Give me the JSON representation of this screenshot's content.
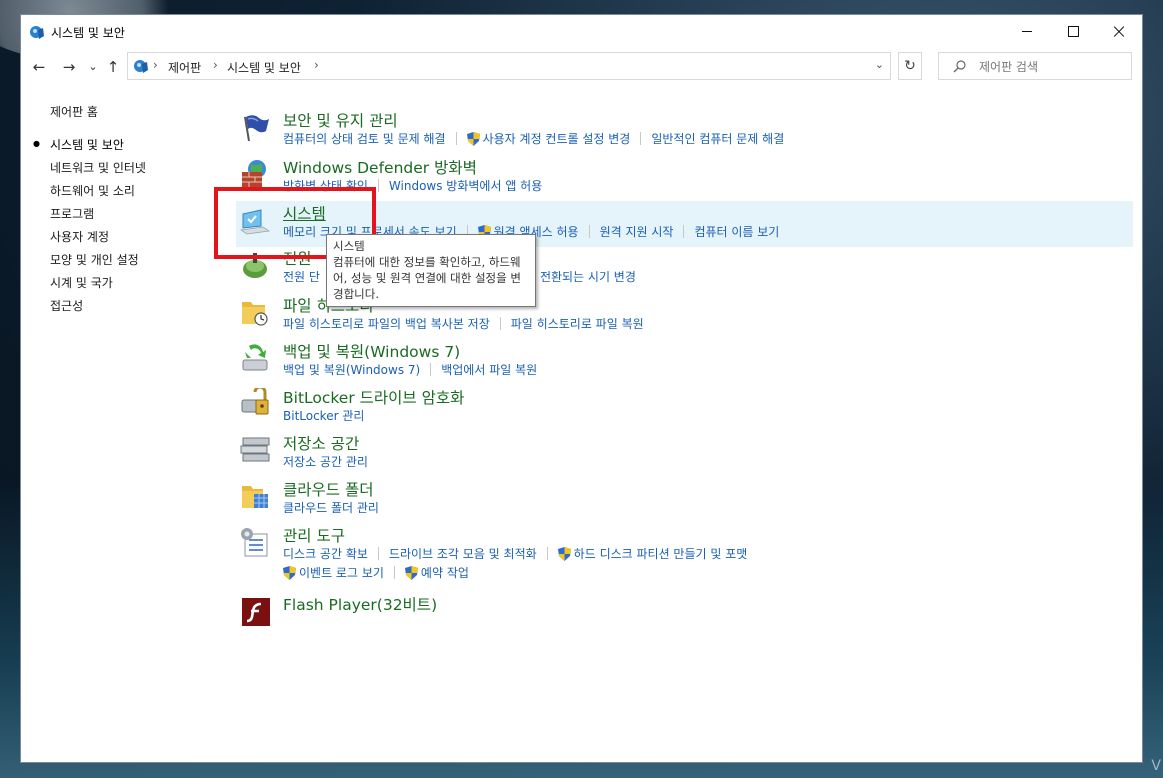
{
  "window": {
    "title": "시스템 및 보안",
    "controls": {
      "minimize": "minimize",
      "maximize": "maximize",
      "close": "×"
    }
  },
  "nav": {
    "back": "←",
    "forward": "→",
    "recent": "⌄",
    "up": "↑",
    "breadcrumbs": [
      "제어판",
      "시스템 및 보안"
    ],
    "refresh": "↻",
    "search_placeholder": "제어판 검색"
  },
  "sidebar": {
    "items": [
      {
        "label": "제어판 홈",
        "current": false
      },
      {
        "label": "시스템 및 보안",
        "current": true
      },
      {
        "label": "네트워크 및 인터넷",
        "current": false
      },
      {
        "label": "하드웨어 및 소리",
        "current": false
      },
      {
        "label": "프로그램",
        "current": false
      },
      {
        "label": "사용자 계정",
        "current": false
      },
      {
        "label": "모양 및 개인 설정",
        "current": false
      },
      {
        "label": "시계 및 국가",
        "current": false
      },
      {
        "label": "접근성",
        "current": false
      }
    ]
  },
  "categories": [
    {
      "title": "보안 및 유지 관리",
      "icon": "flag-icon",
      "links": [
        "컴퓨터의 상태 검토 및 문제 해결",
        "사용자 계정 컨트롤 설정 변경",
        "일반적인 컴퓨터 문제 해결"
      ]
    },
    {
      "title": "Windows Defender 방화벽",
      "icon": "firewall-icon",
      "links": [
        "방화벽 상태 확인",
        "Windows 방화벽에서 앱 허용"
      ]
    },
    {
      "title": "시스템",
      "icon": "system-icon",
      "links": [
        "메모리 크기 및 프로세서 속도 보기",
        "원격 액세스 허용",
        "원격 지원 시작",
        "컴퓨터 이름 보기"
      ]
    },
    {
      "title": "전원",
      "icon": "power-icon",
      "links": [
        "전원 단",
        "전환되는 시기 변경"
      ]
    },
    {
      "title": "파일 히스토리",
      "icon": "file-history-icon",
      "links": [
        "파일 히스토리로 파일의 백업 복사본 저장",
        "파일 히스토리로 파일 복원"
      ]
    },
    {
      "title": "백업 및 복원(Windows 7)",
      "icon": "backup-icon",
      "links": [
        "백업 및 복원(Windows 7)",
        "백업에서 파일 복원"
      ]
    },
    {
      "title": "BitLocker 드라이브 암호화",
      "icon": "bitlocker-icon",
      "links": [
        "BitLocker 관리"
      ]
    },
    {
      "title": "저장소 공간",
      "icon": "storage-icon",
      "links": [
        "저장소 공간 관리"
      ]
    },
    {
      "title": "클라우드 폴더",
      "icon": "cloud-folder-icon",
      "links": [
        "클라우드 폴더 관리"
      ]
    },
    {
      "title": "관리 도구",
      "icon": "admin-tools-icon",
      "links": [
        "디스크 공간 확보",
        "드라이브 조각 모음 및 최적화",
        "하드 디스크 파티션 만들기 및 포맷",
        "이벤트 로그 보기",
        "예약 작업"
      ]
    },
    {
      "title": "Flash Player(32비트)",
      "icon": "flash-icon",
      "links": []
    }
  ],
  "tooltip": {
    "title": "시스템",
    "body": "컴퓨터에 대한 정보를 확인하고, 하드웨어, 성능 및 원격 연결에 대한 설정을 변경합니다."
  },
  "colors": {
    "category_title": "#1a6b22",
    "link": "#1a5fb4",
    "highlight": "#e5f3fb",
    "annotation_box": "#e3141c"
  },
  "corner_glyph": "V"
}
